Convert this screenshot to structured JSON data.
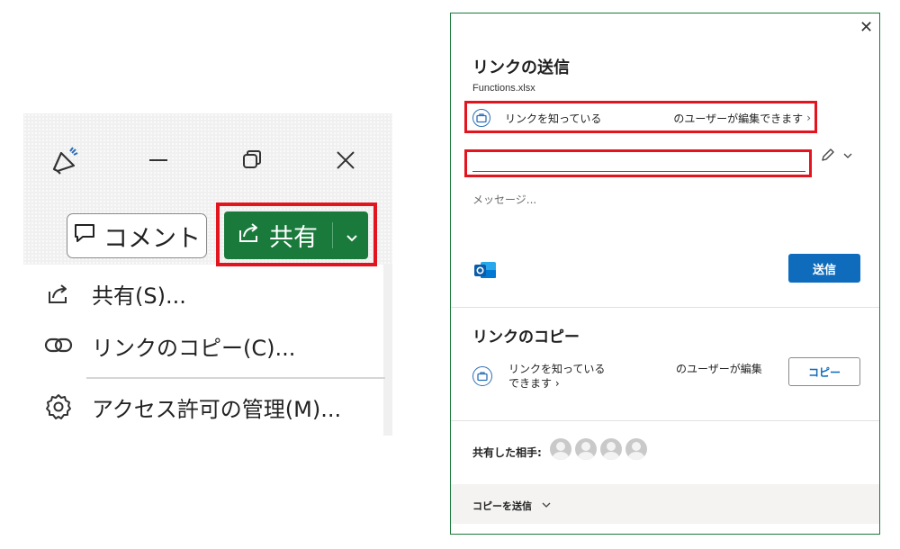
{
  "left_panel": {
    "title_icons": [
      "megaphone-icon",
      "minimize-icon",
      "restore-icon",
      "close-icon"
    ],
    "comment_button": {
      "label": "コメント",
      "icon": "comment-icon"
    },
    "share_button": {
      "label": "共有",
      "icon": "share-icon",
      "chevron": "chevron-down-icon"
    },
    "menu_items": [
      {
        "label": "共有(S)...",
        "icon": "share-icon"
      },
      {
        "label": "リンクのコピー(C)...",
        "icon": "link-icon"
      },
      {
        "label": "アクセス許可の管理(M)...",
        "icon": "gear-icon"
      }
    ],
    "highlight_color": "#e3141e",
    "share_color": "#1a7a3c"
  },
  "dialog": {
    "close_label": "✕",
    "title": "リンクの送信",
    "file_name": "Functions.xlsx",
    "permission": {
      "scope": "リンクを知っている",
      "rights": "のユーザーが編集できます",
      "arrow": "›"
    },
    "to_input": {
      "value": "",
      "placeholder": ""
    },
    "message_placeholder": "メッセージ...",
    "send_button": "送信",
    "copy_section": {
      "title": "リンクのコピー",
      "scope_line1": "リンクを知っている",
      "scope_line2": "できます ›",
      "rights": "のユーザーが編集",
      "copy_button": "コピー"
    },
    "shared_with_label": "共有した相手:",
    "avatar_count": 4,
    "footer": {
      "label": "コピーを送信",
      "chevron": "chevron-down-icon"
    },
    "accent_color": "#0f6cbd"
  }
}
